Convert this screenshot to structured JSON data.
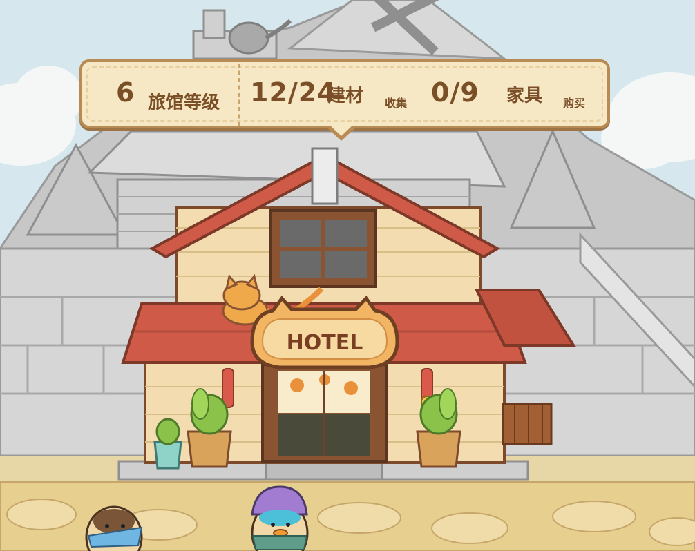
{
  "hud": {
    "level_value": "6",
    "level_label": "旅馆等级",
    "materials_value": "12/24",
    "materials_label": "建材",
    "materials_sub": "收集",
    "furniture_value": "0/9",
    "furniture_label": "家具",
    "furniture_sub": "购买"
  },
  "hotel": {
    "sign_text": "HOTEL"
  },
  "colors": {
    "banner_bg": "#f6e7c5",
    "banner_border": "#b98b54",
    "text_brown": "#7a4f28",
    "roof_red": "#cf5a47",
    "wall_cream": "#f3ddb0",
    "cat_orange": "#f0a94a"
  }
}
